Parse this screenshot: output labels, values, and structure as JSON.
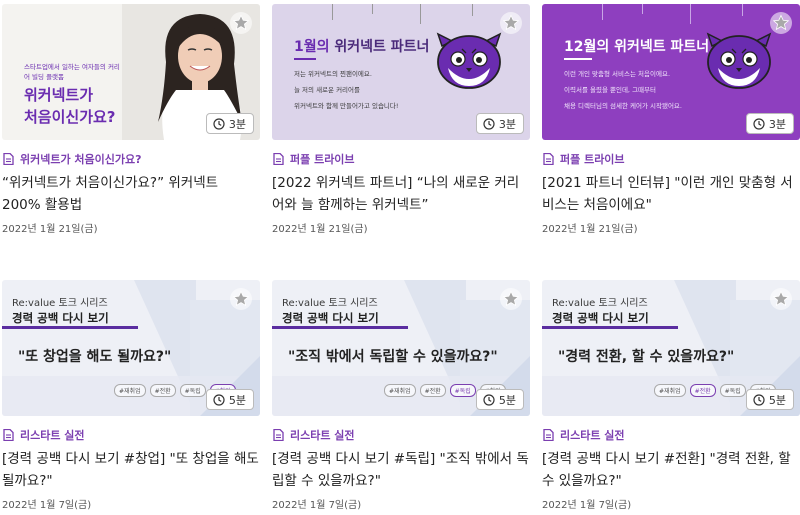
{
  "cards": [
    {
      "category": "위커넥트가 처음이신가요?",
      "title": "“위커넥트가 처음이신가요?” 위커넥트 200% 활용법",
      "date": "2022년 1월 21일(금)",
      "duration": "3분",
      "thumb": {
        "small_text": "스타트업에서 일하는 여자들의 커리어 빌딩 플랫폼",
        "big_line1": "위커넥트가",
        "big_line2": "처음이신가요?"
      }
    },
    {
      "category": "퍼플 트라이브",
      "title": "[2022 위커넥트 파트너] “나의 새로운 커리어와 늘 함께하는 위커넥트”",
      "date": "2022년 1월 21일(금)",
      "duration": "3분",
      "thumb": {
        "month": "1월의",
        "rest": " 위커넥트 파트너",
        "lines": [
          "저는 위커넥트의 찐팬이에요.",
          "늘 저의 새로운 커리어를",
          "위커넥트와 함께 만들어가고 있습니다!"
        ]
      }
    },
    {
      "category": "퍼플 트라이브",
      "title": "[2021 파트너 인터뷰] \"이런 개인 맞춤형 서비스는 처음이에요\"",
      "date": "2022년 1월 21일(금)",
      "duration": "3분",
      "thumb": {
        "month": "12월의",
        "rest": " 위커넥트 파트너",
        "lines": [
          "이런 개인 맞춤형 서비스는 처음이에요.",
          "이력서를 올렸을 뿐인데, 그때부터",
          "채용 디렉터님의 섬세한 케어가 시작됐어요."
        ]
      }
    },
    {
      "category": "리스타트 실전",
      "title": "[경력 공백 다시 보기 #창업] \"또 창업을 해도 될까요?\"",
      "date": "2022년 1월 7일(금)",
      "duration": "5분",
      "thumb": {
        "series": "Re:value 토크 시리즈",
        "main": "경력 공백 다시 보기",
        "quote": "\"또 창업을 해도 될까요?\"",
        "tags": [
          "#재취업",
          "#전환",
          "#독립",
          "#창업"
        ]
      }
    },
    {
      "category": "리스타트 실전",
      "title": "[경력 공백 다시 보기 #독립] \"조직 밖에서 독립할 수 있을까요?\"",
      "date": "2022년 1월 7일(금)",
      "duration": "5분",
      "thumb": {
        "series": "Re:value 토크 시리즈",
        "main": "경력 공백 다시 보기",
        "quote": "\"조직 밖에서 독립할 수 있을까요?\"",
        "tags": [
          "#재취업",
          "#전환",
          "#독립",
          "#창업"
        ]
      }
    },
    {
      "category": "리스타트 실전",
      "title": "[경력 공백 다시 보기 #전환] \"경력 전환, 할 수 있을까요?\"",
      "date": "2022년 1월 7일(금)",
      "duration": "5분",
      "thumb": {
        "series": "Re:value 토크 시리즈",
        "main": "경력 공백 다시 보기",
        "quote": "\"경력 전환, 할 수 있을까요?\"",
        "tags": [
          "#재취업",
          "#전환",
          "#독립",
          "#창업"
        ]
      }
    }
  ],
  "colors": {
    "accent": "#7b3fb0",
    "thumb2_bg": "#dcd4ea",
    "thumb3_bg": "#8e3fbf"
  }
}
